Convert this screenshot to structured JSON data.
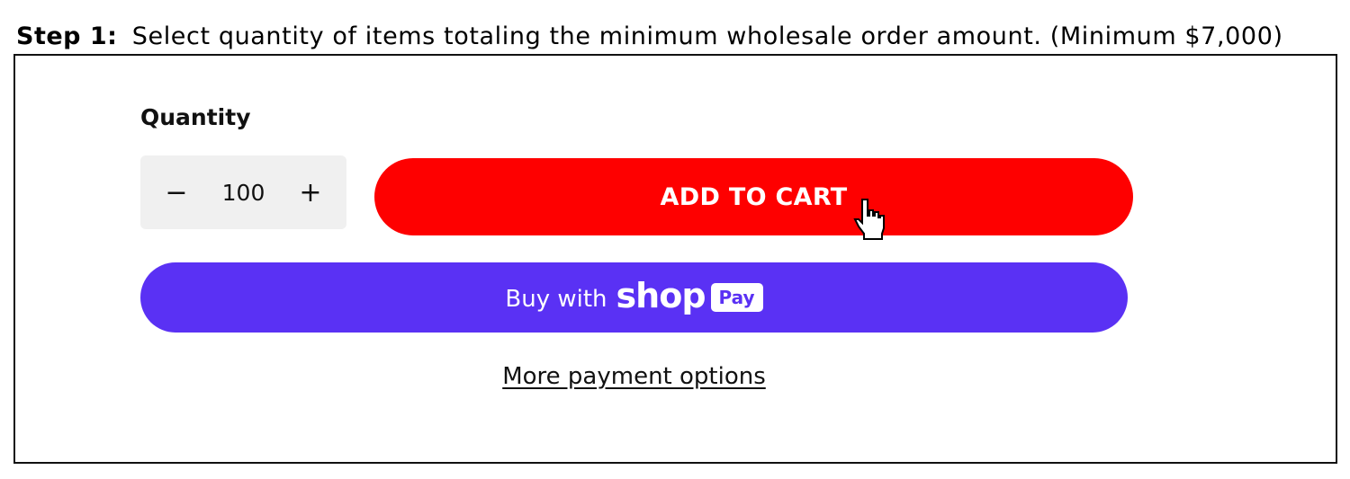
{
  "heading": {
    "step_label": "Step 1:",
    "step_text": "Select quantity of items totaling the minimum wholesale order amount. (Minimum $7,000)"
  },
  "quantity": {
    "label": "Quantity",
    "decrement_symbol": "−",
    "increment_symbol": "+",
    "value": "100"
  },
  "actions": {
    "add_to_cart": "ADD TO CART",
    "buy_with": "Buy with",
    "shop_word": "shop",
    "pay_badge": "Pay",
    "more_payment_options": "More payment options"
  },
  "colors": {
    "add_to_cart_bg": "#fe0000",
    "shop_pay_bg": "#5a31f4",
    "stepper_bg": "#f0f0f0"
  },
  "icons": {
    "cursor": "hand-pointer-icon"
  }
}
